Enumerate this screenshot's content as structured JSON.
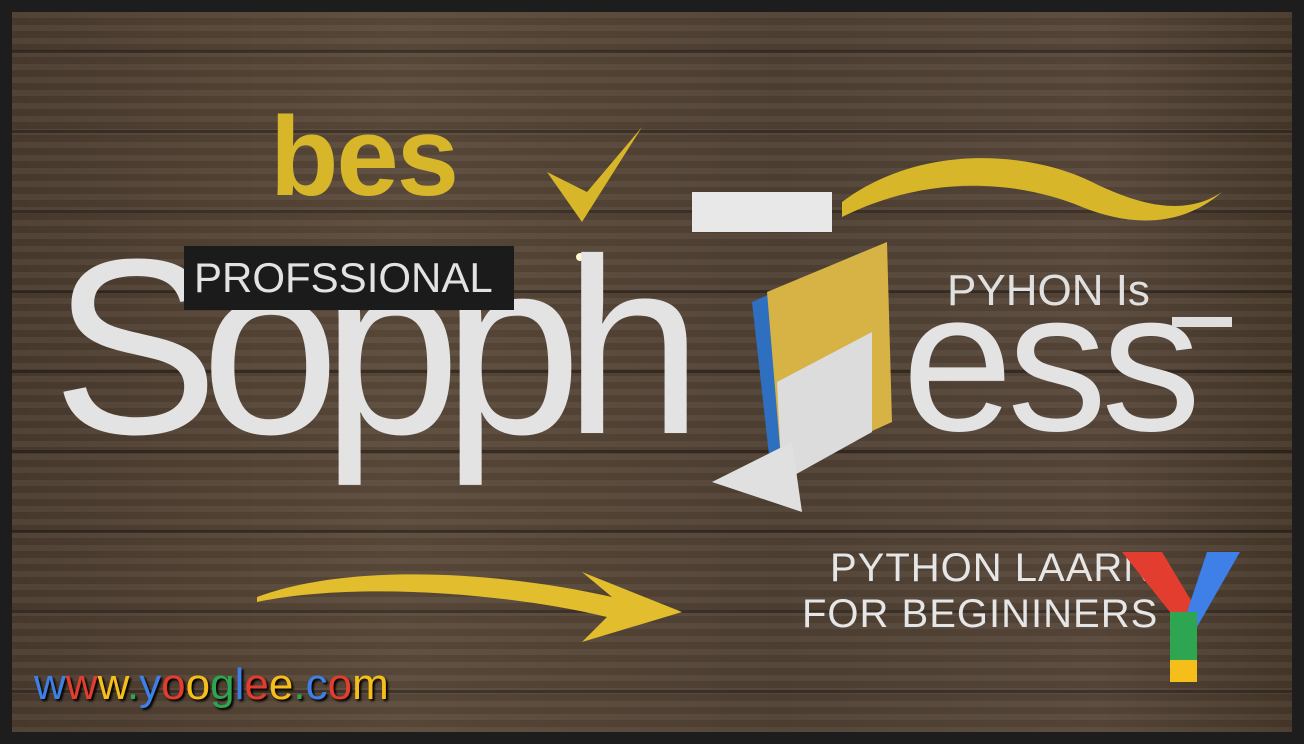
{
  "headline_fragment": "bes",
  "label_box": "PROFSSIONAL",
  "big_text_left": "Sopph",
  "big_text_right": "ess",
  "side_label": "PYHON Is",
  "subtitle_line1": "PYTHON LAARN",
  "subtitle_line2": "FOR BEGININERS",
  "url_letters": [
    {
      "ch": "w",
      "c": "b"
    },
    {
      "ch": "w",
      "c": "r"
    },
    {
      "ch": "w",
      "c": "y"
    },
    {
      "ch": ".",
      "c": "g"
    },
    {
      "ch": "y",
      "c": "b"
    },
    {
      "ch": "o",
      "c": "r"
    },
    {
      "ch": "o",
      "c": "y"
    },
    {
      "ch": "g",
      "c": "g"
    },
    {
      "ch": "l",
      "c": "b"
    },
    {
      "ch": "e",
      "c": "r"
    },
    {
      "ch": "e",
      "c": "y"
    },
    {
      "ch": ".",
      "c": "g"
    },
    {
      "ch": "c",
      "c": "b"
    },
    {
      "ch": "o",
      "c": "r"
    },
    {
      "ch": "m",
      "c": "y"
    }
  ],
  "colors": {
    "blue": "#3f7fe8",
    "red": "#e23d2f",
    "yellow": "#f5be1b",
    "green": "#2ea550",
    "gold": "#d8b62a"
  }
}
